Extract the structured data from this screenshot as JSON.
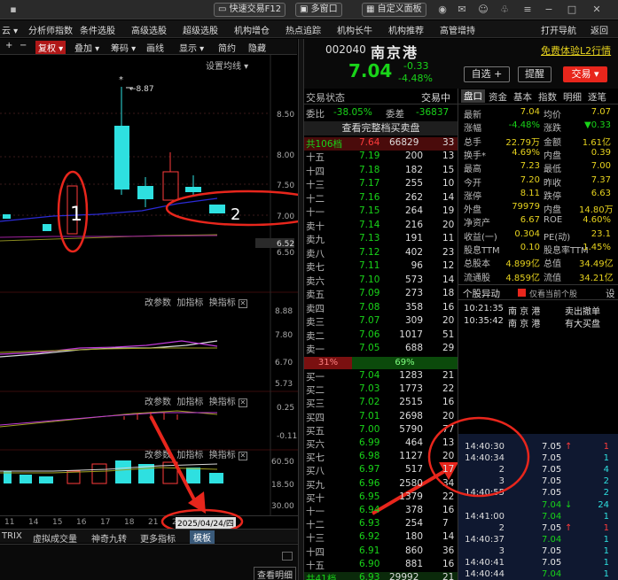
{
  "topbar": {
    "fast_trade": "快速交易F12",
    "multi_window": "多窗口",
    "custom_panel": "自定义面板"
  },
  "menubar": {
    "items": [
      "云 ▾",
      "分析师指数",
      "条件选股",
      "高级选股",
      "超级选股",
      "机构增仓",
      "热点追踪",
      "机构长牛",
      "机构推荐",
      "高管增持"
    ],
    "open_nav": "打开导航",
    "back": "返回"
  },
  "chart_toolbar": {
    "plus": "+",
    "minus": "−",
    "items": [
      "复权 ▾",
      "叠加 ▾",
      "筹码 ▾",
      "画线",
      "显示 ▾",
      "简约",
      "隐藏"
    ],
    "mean_setting": "设置均线 ▾"
  },
  "price_axis": [
    "8.50",
    "8.00",
    "7.50",
    "7.00",
    "6.52",
    "6.50"
  ],
  "high_annot": "8.87",
  "pane2": {
    "hdr": [
      "改参数",
      "加指标",
      "换指标"
    ],
    "axis": [
      "8.88",
      "7.80",
      "6.70",
      "5.73"
    ]
  },
  "pane3": {
    "hdr": [
      "改参数",
      "加指标",
      "换指标"
    ],
    "axis": [
      "0.25",
      "-0.11"
    ]
  },
  "pane4": {
    "hdr": [
      "改参数",
      "加指标",
      "换指标"
    ],
    "axis": [
      "60.50",
      "18.50",
      "30.00"
    ]
  },
  "x_labels": [
    "11",
    "14",
    "15",
    "16",
    "17",
    "18",
    "21",
    "22"
  ],
  "date_tag": "2025/04/24/四",
  "bottom_tabs": [
    "TRIX",
    "虚拟成交量",
    "神奇九转",
    "更多指标",
    "模板"
  ],
  "annot": {
    "one": "1",
    "two": "2"
  },
  "stock": {
    "code": "002040",
    "name": "南京港",
    "promo": "免费体验L2行情",
    "price": "7.04",
    "change": "-0.33",
    "pct": "-4.48%"
  },
  "buttons": {
    "watch": "自选 +",
    "alert": "提醒",
    "trade": "交易"
  },
  "tabs_left": {
    "trade_status": "交易状态",
    "trading": "交易中"
  },
  "tabs_right": [
    "盘口",
    "资金",
    "基本",
    "指数",
    "明细",
    "逐笔"
  ],
  "weibi": {
    "l1": "委比",
    "v1": "-38.05%",
    "l2": "委差",
    "v2": "-36837"
  },
  "view_full": "查看完整档买卖盘",
  "total_levels": {
    "label": "共106档",
    "price": "7.64",
    "vol": "66829",
    "n": "33"
  },
  "asks": [
    [
      "十五",
      "7.19",
      "200",
      "13"
    ],
    [
      "十四",
      "7.18",
      "182",
      "15"
    ],
    [
      "十三",
      "7.17",
      "255",
      "10"
    ],
    [
      "十二",
      "7.16",
      "262",
      "14"
    ],
    [
      "十一",
      "7.15",
      "264",
      "19"
    ],
    [
      "卖十",
      "7.14",
      "216",
      "20"
    ],
    [
      "卖九",
      "7.13",
      "191",
      "11"
    ],
    [
      "卖八",
      "7.12",
      "402",
      "23"
    ],
    [
      "卖七",
      "7.11",
      "96",
      "12"
    ],
    [
      "卖六",
      "7.10",
      "573",
      "14"
    ],
    [
      "卖五",
      "7.09",
      "273",
      "18"
    ],
    [
      "卖四",
      "7.08",
      "358",
      "16"
    ],
    [
      "卖三",
      "7.07",
      "309",
      "20"
    ],
    [
      "卖二",
      "7.06",
      "1017",
      "51"
    ],
    [
      "卖一",
      "7.05",
      "688",
      "29"
    ]
  ],
  "ratio": {
    "sell": "31%",
    "buy": "69%"
  },
  "bids": [
    [
      "买一",
      "7.04",
      "1283",
      "21"
    ],
    [
      "买二",
      "7.03",
      "1773",
      "22"
    ],
    [
      "买三",
      "7.02",
      "2515",
      "16"
    ],
    [
      "买四",
      "7.01",
      "2698",
      "20"
    ],
    [
      "买五",
      "7.00",
      "5790",
      "77"
    ],
    [
      "买六",
      "6.99",
      "464",
      "13"
    ],
    [
      "买七",
      "6.98",
      "1127",
      "20"
    ],
    [
      "买八",
      "6.97",
      "517",
      "17"
    ],
    [
      "买九",
      "6.96",
      "2580",
      "34"
    ],
    [
      "买十",
      "6.95",
      "1379",
      "22"
    ],
    [
      "十一",
      "6.94",
      "378",
      "16"
    ],
    [
      "十二",
      "6.93",
      "254",
      "7"
    ],
    [
      "十三",
      "6.92",
      "180",
      "14"
    ],
    [
      "十四",
      "6.91",
      "860",
      "36"
    ],
    [
      "十五",
      "6.90",
      "881",
      "16"
    ]
  ],
  "total_bid": {
    "label": "共41档",
    "price": "6.93",
    "vol": "29992",
    "n": "21"
  },
  "stats": [
    [
      "最新",
      "7.04",
      "均价",
      "7.07"
    ],
    [
      "涨幅",
      "-4.48%",
      "涨跌",
      "▼0.33"
    ],
    [
      "总手",
      "22.79万",
      "金额",
      "1.61亿"
    ],
    [
      "换手*",
      "4.69%",
      "内盘",
      "0.39"
    ],
    [
      "最高",
      "7.23",
      "最低",
      "7.00"
    ],
    [
      "今开",
      "7.20",
      "昨收",
      "7.37"
    ],
    [
      "涨停",
      "8.11",
      "跌停",
      "6.63"
    ],
    [
      "外盘",
      "79979",
      "内盘",
      "14.80万"
    ],
    [
      "净资产",
      "6.67",
      "ROE",
      "4.60%"
    ],
    [
      "收益(一)",
      "0.304",
      "PE(动)",
      "23.1"
    ],
    [
      "股息TTM",
      "0.10",
      "股息率TTM",
      "1.45%"
    ],
    [
      "总股本",
      "4.899亿",
      "总值",
      "34.49亿"
    ],
    [
      "流通股",
      "4.859亿",
      "流值",
      "34.21亿"
    ]
  ],
  "anomaly": {
    "title": "个股异动",
    "only": "仅看当前个股",
    "set": "设"
  },
  "events": [
    [
      "10:21:35",
      "南 京 港",
      "卖出撤单"
    ],
    [
      "10:35:42",
      "南 京 港",
      "有大买盘"
    ]
  ],
  "ticks": [
    [
      "14:40:30",
      "7.05",
      "↑",
      "1"
    ],
    [
      "14:40:34",
      "7.05",
      "",
      "1"
    ],
    [
      "2",
      "7.05",
      "",
      "4"
    ],
    [
      "3",
      "7.05",
      "",
      "2"
    ],
    [
      "14:40:55",
      "7.05",
      "",
      "2"
    ],
    [
      "",
      "7.04",
      "↓",
      "24"
    ],
    [
      "14:41:00",
      "7.04",
      "",
      "1"
    ],
    [
      "2",
      "7.05",
      "↑",
      "1"
    ],
    [
      "14:40:37",
      "7.04",
      "",
      "1"
    ],
    [
      "3",
      "7.05",
      "",
      "1"
    ],
    [
      "14:40:41",
      "7.05",
      "",
      "1"
    ],
    [
      "14:40:44",
      "7.04",
      "",
      "1"
    ]
  ],
  "bottom": {
    "view_detail": "查看明细"
  },
  "colors": {
    "red": "#ff3b3b",
    "green": "#19d419",
    "cyan": "#2ee0e0",
    "yellow": "#e6d21e",
    "annotation": "#e8261c"
  }
}
